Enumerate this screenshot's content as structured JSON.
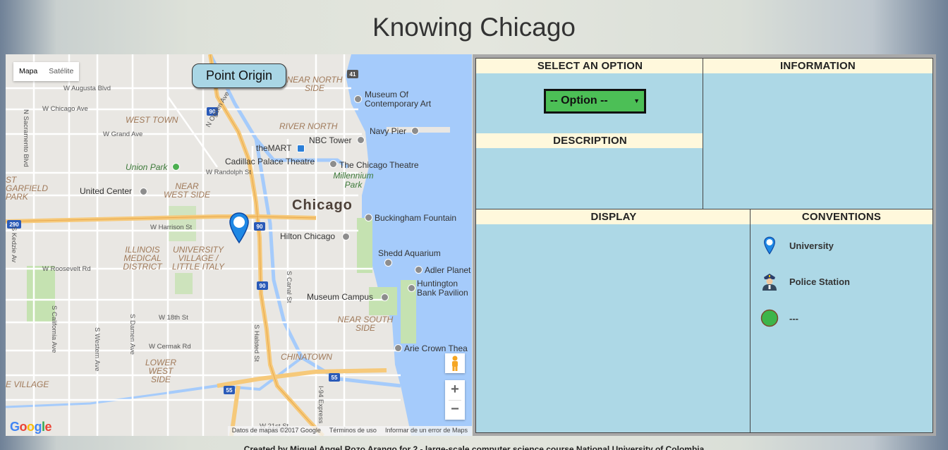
{
  "page": {
    "title": "Knowing Chicago"
  },
  "map": {
    "type_controls": {
      "map": "Mapa",
      "satellite": "Satélite"
    },
    "origin_button": "Point Origin",
    "city_label": "Chicago",
    "areas": [
      "WEST TOWN",
      "RIVER NORTH",
      "NEAR NORTH SIDE",
      "NEAR WEST SIDE",
      "ST GARFIELD PARK",
      "ILLINOIS MEDICAL DISTRICT",
      "UNIVERSITY VILLAGE / LITTLE ITALY",
      "NEAR SOUTH SIDE",
      "CHINATOWN",
      "LOWER WEST SIDE",
      "E VILLAGE"
    ],
    "places": [
      "Museum Of Contemporary Art",
      "Navy Pier",
      "NBC Tower",
      "theMART",
      "Cadillac Palace Theatre",
      "The Chicago Theatre",
      "Millennium Park",
      "Union Park",
      "United Center",
      "Buckingham Fountain",
      "Hilton Chicago",
      "Shedd Aquarium",
      "Adler Planet",
      "Huntington Bank Pavilion",
      "Museum Campus",
      "Arie Crown Thea"
    ],
    "streets": [
      "W Augusta Blvd",
      "W Chicago Ave",
      "W Grand Ave",
      "W Randolph St",
      "W Harrison St",
      "W Roosevelt Rd",
      "W 18th St",
      "W Cermak Rd",
      "W 21st St",
      "N Sacramento Blvd",
      "N Ogden Ave",
      "S Kedzie Av",
      "S California Ave",
      "S Damen Ave",
      "S Western Ave",
      "S Halsted St",
      "S Canal St",
      "I-94 Express"
    ],
    "zoom": {
      "in": "+",
      "out": "−"
    },
    "logo": "Google",
    "attribution": {
      "data": "Datos de mapas ©2017 Google",
      "terms": "Términos de uso",
      "report": "Informar de un error de Maps"
    }
  },
  "panel": {
    "select_option": {
      "header": "SELECT AN OPTION",
      "selected": "-- Option --"
    },
    "information": {
      "header": "INFORMATION"
    },
    "description": {
      "header": "DESCRIPTION"
    },
    "display": {
      "header": "DISPLAY"
    },
    "conventions": {
      "header": "CONVENTIONS",
      "items": [
        {
          "icon": "map-pin-icon",
          "label": "University"
        },
        {
          "icon": "police-officer-icon",
          "label": "Police Station"
        },
        {
          "icon": "green-circle-icon",
          "label": "---"
        }
      ]
    }
  },
  "footer": {
    "text": "Created by Miguel Angel Rozo Arango for 2 - large-scale computer science course National University of Colombia"
  },
  "colors": {
    "panel_bg": "#add8e6",
    "header_bg": "#fff8dc",
    "select_bg": "#4cbf56",
    "water": "#a5cbfb",
    "origin_btn": "#a9d6e5"
  }
}
